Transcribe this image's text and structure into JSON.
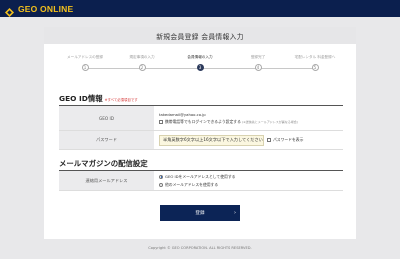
{
  "header": {
    "brand": "GEO ONLINE",
    "brand_color": "#f3c01c",
    "bar_color": "#0b1f4e"
  },
  "page": {
    "title": "新規会員登録 会員情報入力"
  },
  "steps": [
    {
      "label": "メールアドレスの登録",
      "num": "1",
      "active": false
    },
    {
      "label": "規定事項の入力",
      "num": "2",
      "active": false
    },
    {
      "label": "会員情報の入力",
      "num": "3",
      "active": true
    },
    {
      "label": "登録完了",
      "num": "4",
      "active": false
    },
    {
      "label": "宅配レンタル 料金登録へ",
      "num": "5",
      "active": false
    }
  ],
  "geo_id": {
    "title": "GEO ID情報",
    "note": "※すべて必須項目です",
    "id_label": "GEO ID",
    "id_value": "takedamail@yahoo.co.jp",
    "id_checkbox": "携帯電話等でもログインできるよう設定する",
    "id_checkbox_note": "(※送信先とメールアドレスが異なる場合)",
    "pw_label": "パスワード",
    "pw_placeholder": "半角英数字6文字以上16文字以下で入力してください",
    "pw_show": "パスワードを表示"
  },
  "magazine": {
    "title": "メールマガジンの配信設定",
    "label": "連絡用メールアドレス",
    "option1": "GEO IDをメールアドレスとして使用する",
    "option2": "他のメールアドレスを使用する"
  },
  "submit": {
    "label": "登録",
    "arrow": "›"
  },
  "footer": {
    "copyright": "Copyright © GEO CORPORATION. ALL RIGHTS RESERVED."
  }
}
